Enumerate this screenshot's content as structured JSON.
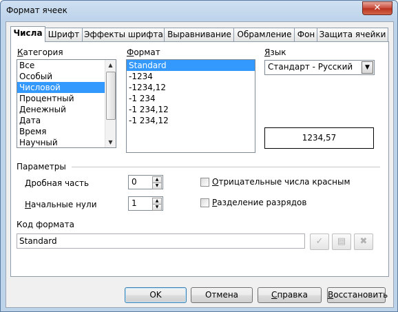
{
  "window": {
    "title": "Формат ячеек",
    "close_label": "✕"
  },
  "tabs": [
    {
      "label": "Числа",
      "active": true
    },
    {
      "label": "Шрифт"
    },
    {
      "label": "Эффекты шрифта"
    },
    {
      "label": "Выравнивание"
    },
    {
      "label": "Обрамление"
    },
    {
      "label": "Фон"
    },
    {
      "label": "Защита ячейки"
    }
  ],
  "category": {
    "label": "Категория",
    "items": [
      "Все",
      "Особый",
      "Числовой",
      "Процентный",
      "Денежный",
      "Дата",
      "Время",
      "Научный"
    ],
    "selected": "Числовой"
  },
  "format": {
    "label": "Формат",
    "items": [
      "Standard",
      "-1234",
      "-1234,12",
      "-1 234",
      "-1 234,12",
      "-1 234,12"
    ],
    "selected": "Standard"
  },
  "language": {
    "label": "Язык",
    "value": "Стандарт - Русский"
  },
  "preview": {
    "value": "1234,57"
  },
  "options": {
    "title": "Параметры",
    "decimal_label": "Дробная часть",
    "decimal_value": "0",
    "leading_label": "Начальные нули",
    "leading_value": "1",
    "negative_red_label": "Отрицательные числа красным",
    "negative_red_checked": false,
    "thousands_label": "Разделение разрядов",
    "thousands_checked": false
  },
  "format_code": {
    "label": "Код формата",
    "value": "Standard"
  },
  "buttons": {
    "ok": "OK",
    "cancel": "Отмена",
    "help": "Справка",
    "reset": "Восстановить"
  }
}
